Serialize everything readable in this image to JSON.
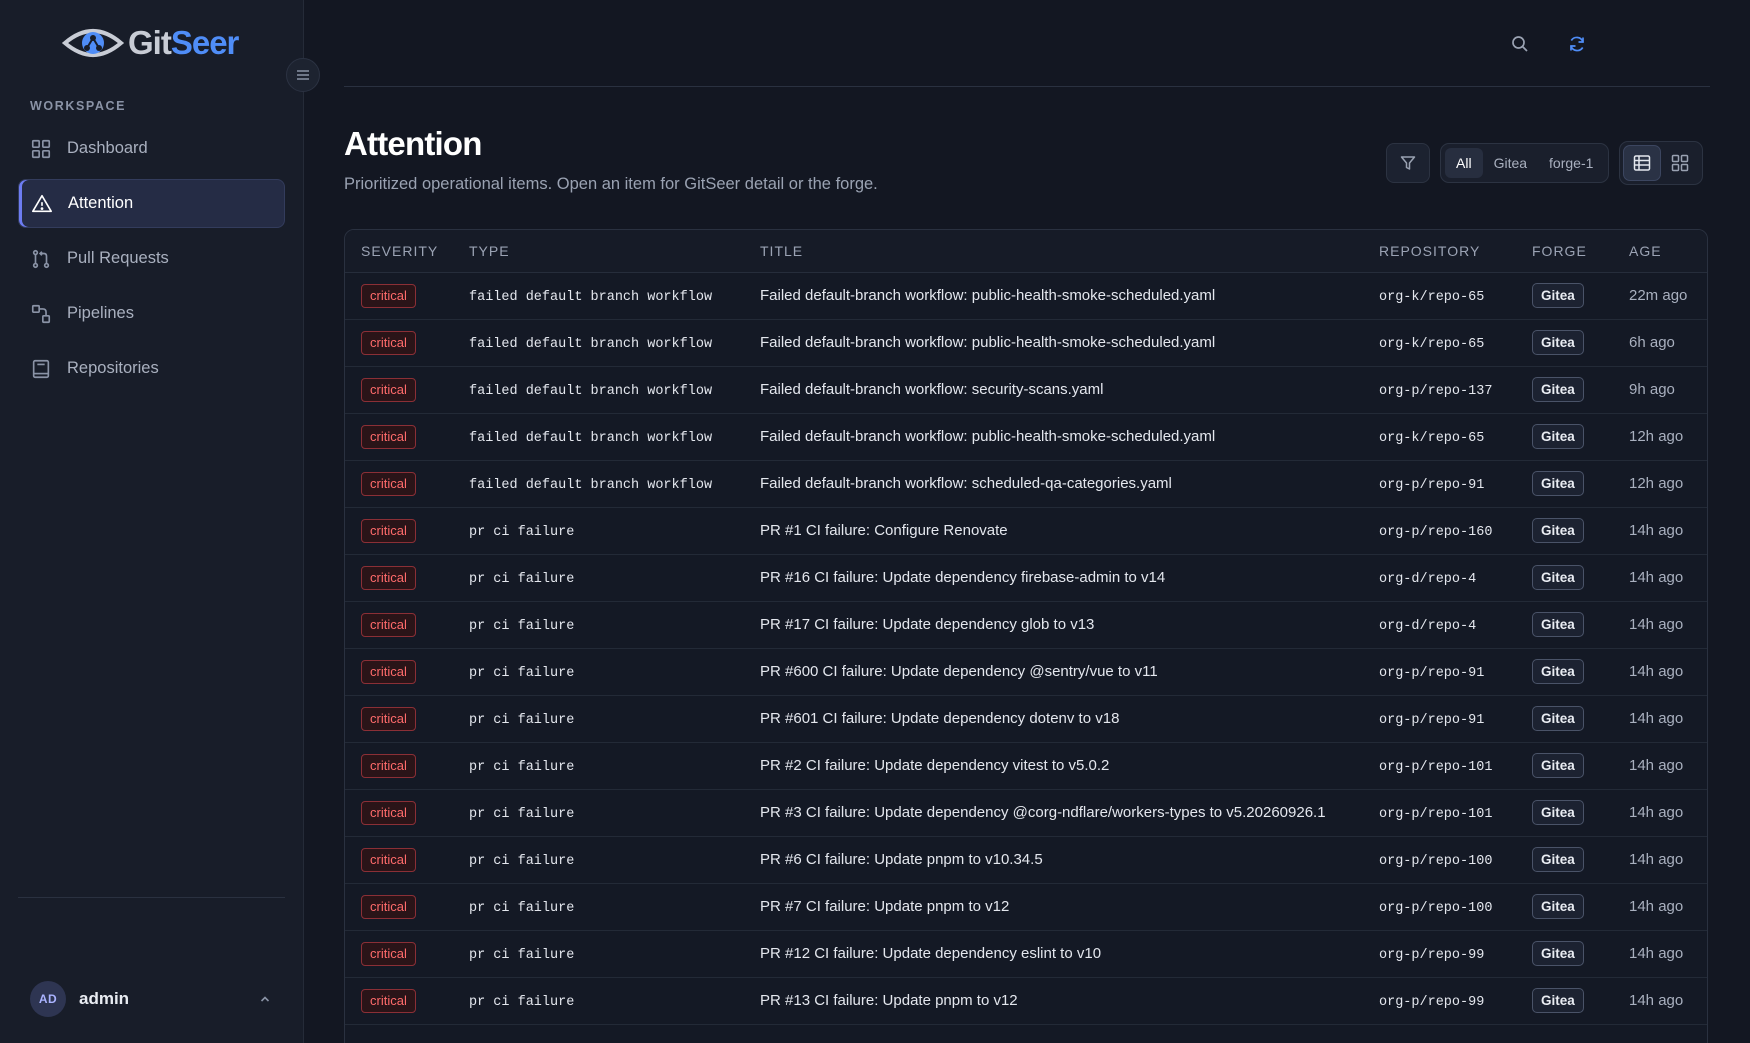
{
  "brand": {
    "name_part1": "Git",
    "name_part2": "Seer"
  },
  "sidebar": {
    "section_label": "WORKSPACE",
    "items": [
      {
        "label": "Dashboard",
        "icon": "grid-icon",
        "active": false
      },
      {
        "label": "Attention",
        "icon": "warning-triangle-icon",
        "active": true
      },
      {
        "label": "Pull Requests",
        "icon": "git-pull-request-icon",
        "active": false
      },
      {
        "label": "Pipelines",
        "icon": "pipeline-icon",
        "active": false
      },
      {
        "label": "Repositories",
        "icon": "repository-icon",
        "active": false
      }
    ],
    "user": {
      "initials": "AD",
      "name": "admin"
    }
  },
  "topbar": {
    "icons": [
      "search-icon",
      "refresh-icon"
    ]
  },
  "page": {
    "title": "Attention",
    "subtitle": "Prioritized operational items. Open an item for GitSeer detail or the forge."
  },
  "filters": {
    "segments": [
      "All",
      "Gitea",
      "forge-1"
    ],
    "active_segment": "All",
    "view_modes": [
      "table-view-icon",
      "grid-view-icon"
    ],
    "active_view": "table-view-icon"
  },
  "table": {
    "columns": [
      "SEVERITY",
      "TYPE",
      "TITLE",
      "REPOSITORY",
      "FORGE",
      "AGE"
    ],
    "rows": [
      {
        "severity": "critical",
        "type": "failed default branch workflow",
        "title": "Failed default-branch workflow: public-health-smoke-scheduled.yaml",
        "repository": "org-k/repo-65",
        "forge": "Gitea",
        "age": "22m ago"
      },
      {
        "severity": "critical",
        "type": "failed default branch workflow",
        "title": "Failed default-branch workflow: public-health-smoke-scheduled.yaml",
        "repository": "org-k/repo-65",
        "forge": "Gitea",
        "age": "6h ago"
      },
      {
        "severity": "critical",
        "type": "failed default branch workflow",
        "title": "Failed default-branch workflow: security-scans.yaml",
        "repository": "org-p/repo-137",
        "forge": "Gitea",
        "age": "9h ago"
      },
      {
        "severity": "critical",
        "type": "failed default branch workflow",
        "title": "Failed default-branch workflow: public-health-smoke-scheduled.yaml",
        "repository": "org-k/repo-65",
        "forge": "Gitea",
        "age": "12h ago"
      },
      {
        "severity": "critical",
        "type": "failed default branch workflow",
        "title": "Failed default-branch workflow: scheduled-qa-categories.yaml",
        "repository": "org-p/repo-91",
        "forge": "Gitea",
        "age": "12h ago"
      },
      {
        "severity": "critical",
        "type": "pr ci failure",
        "title": "PR #1 CI failure: Configure Renovate",
        "repository": "org-p/repo-160",
        "forge": "Gitea",
        "age": "14h ago"
      },
      {
        "severity": "critical",
        "type": "pr ci failure",
        "title": "PR #16 CI failure: Update dependency firebase-admin to v14",
        "repository": "org-d/repo-4",
        "forge": "Gitea",
        "age": "14h ago"
      },
      {
        "severity": "critical",
        "type": "pr ci failure",
        "title": "PR #17 CI failure: Update dependency glob to v13",
        "repository": "org-d/repo-4",
        "forge": "Gitea",
        "age": "14h ago"
      },
      {
        "severity": "critical",
        "type": "pr ci failure",
        "title": "PR #600 CI failure: Update dependency @sentry/vue to v11",
        "repository": "org-p/repo-91",
        "forge": "Gitea",
        "age": "14h ago"
      },
      {
        "severity": "critical",
        "type": "pr ci failure",
        "title": "PR #601 CI failure: Update dependency dotenv to v18",
        "repository": "org-p/repo-91",
        "forge": "Gitea",
        "age": "14h ago"
      },
      {
        "severity": "critical",
        "type": "pr ci failure",
        "title": "PR #2 CI failure: Update dependency vitest to v5.0.2",
        "repository": "org-p/repo-101",
        "forge": "Gitea",
        "age": "14h ago"
      },
      {
        "severity": "critical",
        "type": "pr ci failure",
        "title": "PR #3 CI failure: Update dependency @corg-ndflare/workers-types to v5.20260926.1",
        "repository": "org-p/repo-101",
        "forge": "Gitea",
        "age": "14h ago"
      },
      {
        "severity": "critical",
        "type": "pr ci failure",
        "title": "PR #6 CI failure: Update pnpm to v10.34.5",
        "repository": "org-p/repo-100",
        "forge": "Gitea",
        "age": "14h ago"
      },
      {
        "severity": "critical",
        "type": "pr ci failure",
        "title": "PR #7 CI failure: Update pnpm to v12",
        "repository": "org-p/repo-100",
        "forge": "Gitea",
        "age": "14h ago"
      },
      {
        "severity": "critical",
        "type": "pr ci failure",
        "title": "PR #12 CI failure: Update dependency eslint to v10",
        "repository": "org-p/repo-99",
        "forge": "Gitea",
        "age": "14h ago"
      },
      {
        "severity": "critical",
        "type": "pr ci failure",
        "title": "PR #13 CI failure: Update pnpm to v12",
        "repository": "org-p/repo-99",
        "forge": "Gitea",
        "age": "14h ago"
      }
    ]
  },
  "colors": {
    "accent": "#6d7cf2",
    "brand_blue": "#4f8df7",
    "critical": "#ff6b6b",
    "background": "#131722"
  }
}
